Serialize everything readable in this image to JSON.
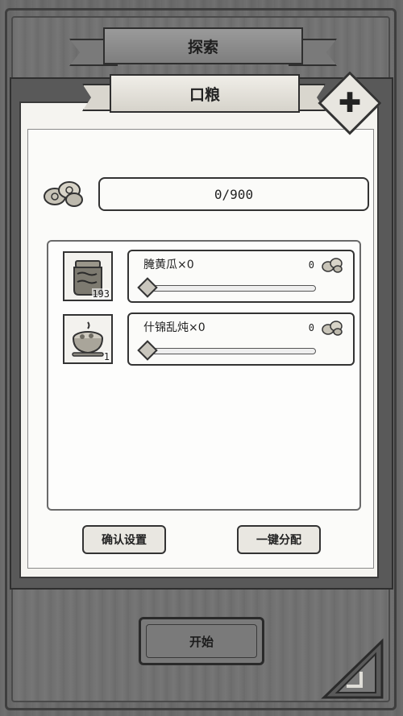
{
  "header": {
    "explore_title": "探索",
    "panel_title": "口粮"
  },
  "capacity": {
    "value": "0/900"
  },
  "items": [
    {
      "name_label": "腌黄瓜×0",
      "owned_count": "193",
      "allocated": "0",
      "slider_fraction": 0,
      "thumb_icon": "pickle-jar-icon"
    },
    {
      "name_label": "什锦乱炖×0",
      "owned_count": "1",
      "allocated": "0",
      "slider_fraction": 0,
      "thumb_icon": "stew-bowl-icon"
    }
  ],
  "buttons": {
    "confirm_label": "确认设置",
    "auto_label": "一键分配",
    "start_label": "开始"
  },
  "icons": {
    "close": "close-icon",
    "coins": "coin-pile-icon",
    "corner": "back-corner-icon"
  }
}
